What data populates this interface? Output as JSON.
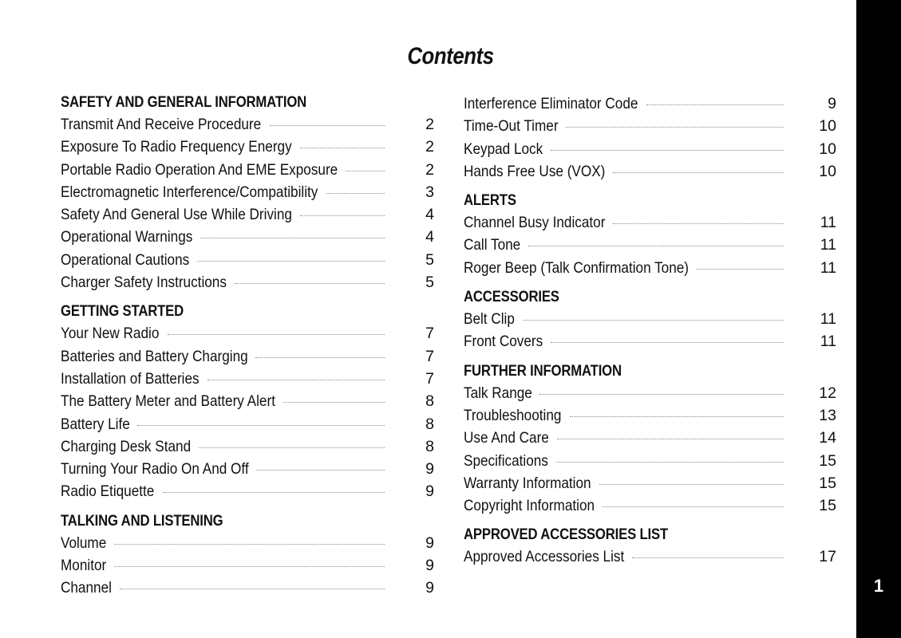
{
  "title": "Contents",
  "page_number": "1",
  "colors": {
    "sidebar": "#000000",
    "text": "#111111",
    "leader": "#8a8a8a"
  },
  "left_column": [
    {
      "heading": "SAFETY AND GENERAL INFORMATION",
      "entries": [
        {
          "label": "Transmit And Receive Procedure",
          "page": "2"
        },
        {
          "label": "Exposure To Radio Frequency Energy",
          "page": "2"
        },
        {
          "label": "Portable Radio Operation And EME Exposure",
          "page": "2"
        },
        {
          "label": "Electromagnetic Interference/Compatibility",
          "page": "3"
        },
        {
          "label": "Safety And General Use While Driving",
          "page": "4"
        },
        {
          "label": "Operational Warnings",
          "page": "4"
        },
        {
          "label": "Operational Cautions",
          "page": "5"
        },
        {
          "label": "Charger Safety Instructions",
          "page": "5"
        }
      ]
    },
    {
      "heading": "GETTING STARTED",
      "entries": [
        {
          "label": "Your New Radio",
          "page": "7"
        },
        {
          "label": "Batteries and Battery Charging",
          "page": "7"
        },
        {
          "label": "Installation of Batteries",
          "page": "7"
        },
        {
          "label": "The Battery Meter and Battery Alert",
          "page": "8"
        },
        {
          "label": "Battery Life",
          "page": "8"
        },
        {
          "label": "Charging Desk Stand",
          "page": "8"
        },
        {
          "label": "Turning Your Radio On And Off",
          "page": "9"
        },
        {
          "label": "Radio Etiquette",
          "page": "9"
        }
      ]
    },
    {
      "heading": "TALKING AND LISTENING",
      "entries": [
        {
          "label": "Volume",
          "page": "9"
        },
        {
          "label": "Monitor",
          "page": "9"
        },
        {
          "label": "Channel",
          "page": "9"
        }
      ]
    }
  ],
  "right_column": [
    {
      "heading": "",
      "entries": [
        {
          "label": "Interference Eliminator Code",
          "page": "9"
        },
        {
          "label": "Time-Out Timer",
          "page": "10"
        },
        {
          "label": "Keypad Lock",
          "page": "10"
        },
        {
          "label": "Hands Free Use (VOX)",
          "page": "10"
        }
      ]
    },
    {
      "heading": "ALERTS",
      "entries": [
        {
          "label": "Channel Busy Indicator",
          "page": "11"
        },
        {
          "label": "Call Tone",
          "page": "11"
        },
        {
          "label": "Roger Beep (Talk Confirmation Tone)",
          "page": "11"
        }
      ]
    },
    {
      "heading": "ACCESSORIES",
      "entries": [
        {
          "label": "Belt Clip",
          "page": "11"
        },
        {
          "label": "Front Covers",
          "page": "11"
        }
      ]
    },
    {
      "heading": "FURTHER INFORMATION",
      "entries": [
        {
          "label": "Talk Range",
          "page": "12"
        },
        {
          "label": "Troubleshooting",
          "page": "13"
        },
        {
          "label": "Use And Care",
          "page": "14"
        },
        {
          "label": "Specifications",
          "page": "15"
        },
        {
          "label": "Warranty Information",
          "page": "15"
        },
        {
          "label": "Copyright Information",
          "page": "15"
        }
      ]
    },
    {
      "heading": "APPROVED ACCESSORIES LIST",
      "entries": [
        {
          "label": "Approved  Accessories List",
          "page": "17"
        }
      ]
    }
  ]
}
